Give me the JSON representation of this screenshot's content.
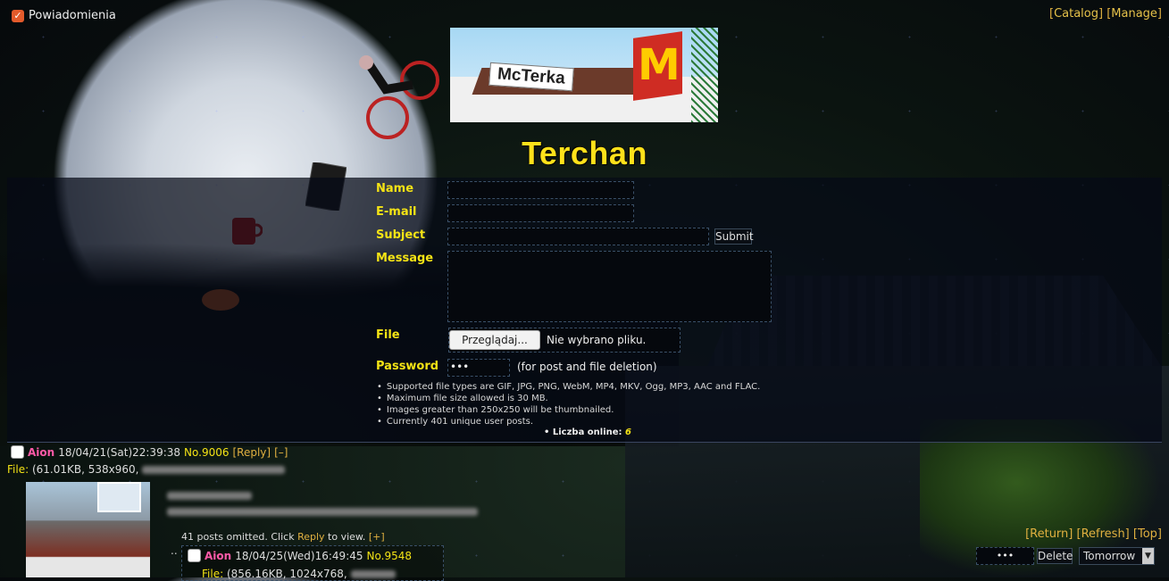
{
  "notification": {
    "label": "Powiadomienia",
    "checked": true
  },
  "top_links": {
    "catalog": "Catalog",
    "manage": "Manage"
  },
  "banner": {
    "text": "McTerka",
    "logo": "M"
  },
  "site": {
    "title": "Terchan"
  },
  "form": {
    "name_label": "Name",
    "email_label": "E-mail",
    "subject_label": "Subject",
    "message_label": "Message",
    "file_label": "File",
    "password_label": "Password",
    "submit_label": "Submit",
    "browse_label": "Przeglądaj...",
    "no_file_text": "Nie wybrano pliku.",
    "password_value": "•••",
    "password_hint": "(for post and file deletion)",
    "rules": [
      "Supported file types are GIF, JPG, PNG, WebM, MP4, MKV, Ogg, MP3, AAC and FLAC.",
      "Maximum file size allowed is 30 MB.",
      "Images greater than 250x250 will be thumbnailed.",
      "Currently 401 unique user posts."
    ],
    "online_label": "Liczba online:",
    "online_count": "6"
  },
  "thread": {
    "author": "Aion",
    "date": "18/04/21(Sat)22:39:38",
    "number": "No.9006",
    "reply_link": "[Reply]",
    "hide_link": "[–]",
    "file_label": "File:",
    "file_info": "(61.01KB, 538x960,",
    "omitted_prefix": "41 posts omitted. Click",
    "omitted_reply": "Reply",
    "omitted_suffix": "to view.",
    "expand": "[+]"
  },
  "reply_post": {
    "dots": "..",
    "author": "Aion",
    "date": "18/04/25(Wed)16:49:45",
    "number": "No.9548",
    "file_label": "File:",
    "file_info": "(856.16KB, 1024x768,"
  },
  "bottom": {
    "return": "[Return]",
    "refresh": "[Refresh]",
    "top": "[Top]",
    "delete_password": "•••",
    "delete_label": "Delete",
    "style_select": "Tomorrow"
  },
  "colors": {
    "accent_yellow": "#f4e315",
    "link_gold": "#e0b040",
    "author_pink": "#ff5aa8"
  }
}
